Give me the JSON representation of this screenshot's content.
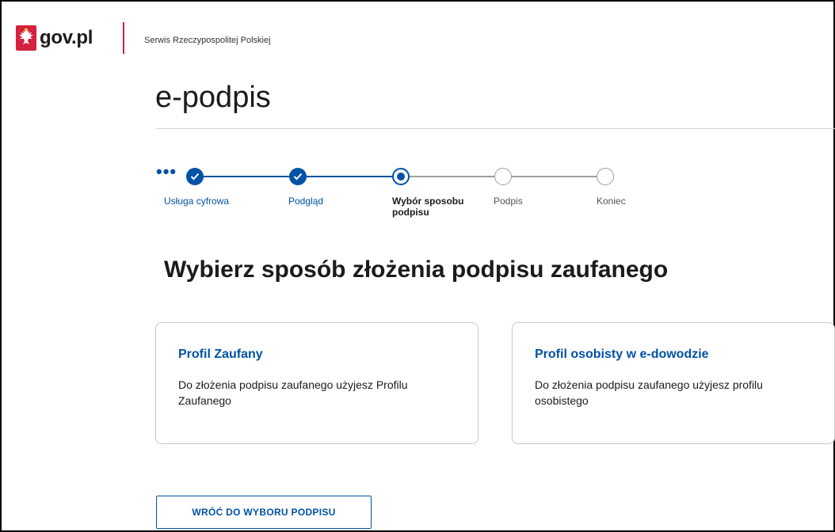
{
  "header": {
    "logo_text": "gov.pl",
    "service_name": "Serwis Rzeczypospolitej Polskiej"
  },
  "app": {
    "title": "e-podpis"
  },
  "stepper": {
    "more_indicator": "•••",
    "steps": [
      {
        "label": "Usługa cyfrowa",
        "state": "done"
      },
      {
        "label": "Podgląd",
        "state": "done"
      },
      {
        "label": "Wybór sposobu podpisu",
        "state": "current"
      },
      {
        "label": "Podpis",
        "state": "todo"
      },
      {
        "label": "Koniec",
        "state": "todo"
      }
    ]
  },
  "main": {
    "heading": "Wybierz sposób złożenia podpisu zaufanego",
    "options": [
      {
        "title": "Profil Zaufany",
        "description": "Do złożenia podpisu zaufanego użyjesz Profilu Zaufanego"
      },
      {
        "title": "Profil osobisty w e-dowodzie",
        "description": "Do złożenia podpisu zaufanego użyjesz profilu osobistego"
      }
    ],
    "back_button_label": "WRÓĆ DO WYBORU PODPISU"
  },
  "colors": {
    "primary": "#0052a5",
    "brand_red": "#d4213d",
    "inactive": "#9e9e9e"
  }
}
